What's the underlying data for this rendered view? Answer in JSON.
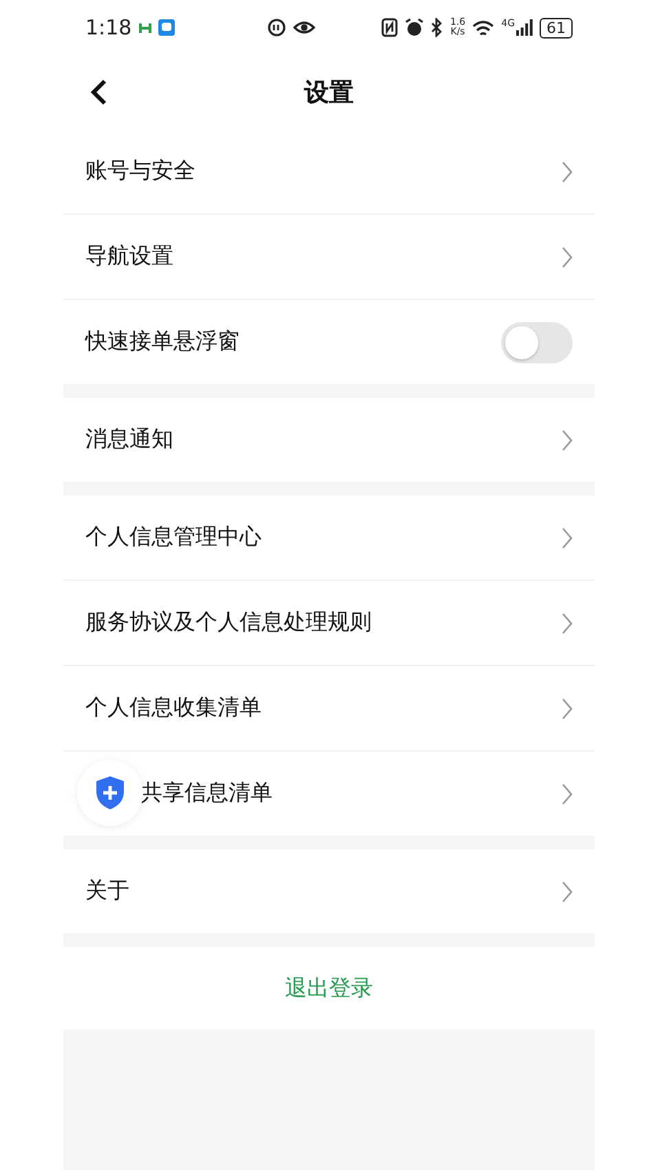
{
  "status_bar": {
    "time": "1:18",
    "net_speed": "1.6",
    "net_unit": "K/s",
    "network": "4G",
    "battery": "61"
  },
  "header": {
    "title": "设置"
  },
  "groups": [
    {
      "items": [
        {
          "label": "账号与安全",
          "kind": "link"
        },
        {
          "label": "导航设置",
          "kind": "link"
        },
        {
          "label": "快速接单悬浮窗",
          "kind": "toggle",
          "on": false
        }
      ]
    },
    {
      "items": [
        {
          "label": "消息通知",
          "kind": "link"
        }
      ]
    },
    {
      "items": [
        {
          "label": "个人信息管理中心",
          "kind": "link"
        },
        {
          "label": "服务协议及个人信息处理规则",
          "kind": "link"
        },
        {
          "label": "个人信息收集清单",
          "kind": "link"
        },
        {
          "label": "共享信息清单",
          "kind": "covered"
        }
      ]
    },
    {
      "items": [
        {
          "label": "关于",
          "kind": "link"
        }
      ]
    }
  ],
  "logout": {
    "label": "退出登录"
  }
}
